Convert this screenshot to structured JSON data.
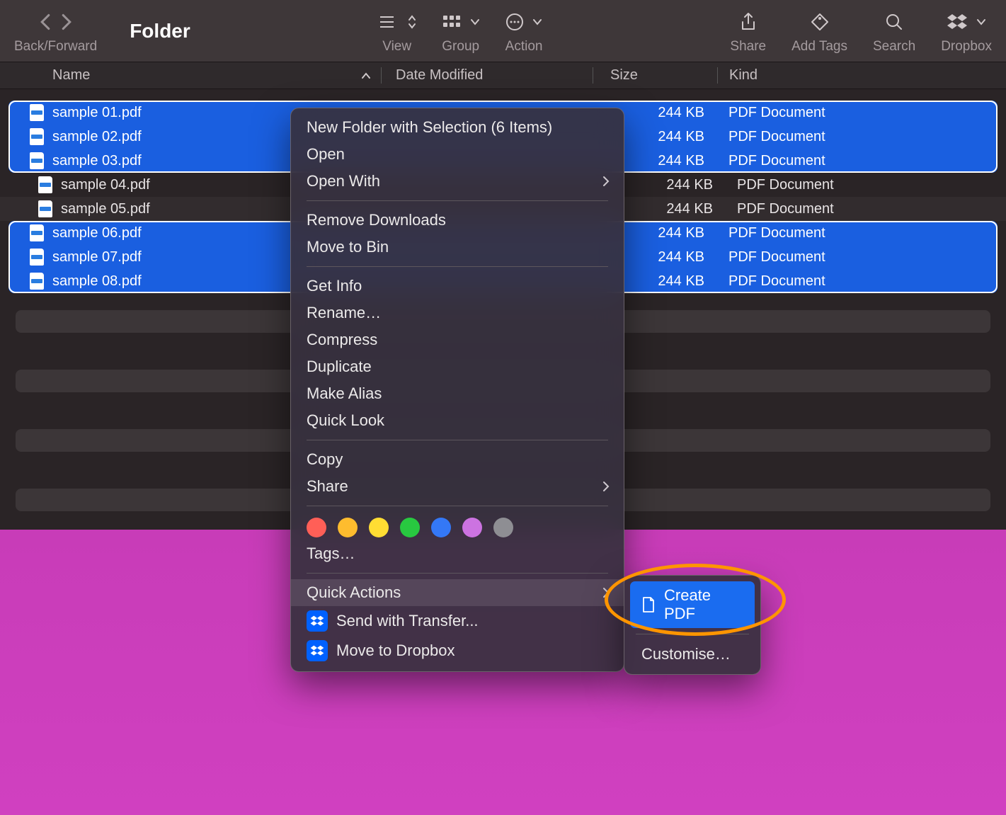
{
  "window": {
    "title": "Folder"
  },
  "toolbar": {
    "back_forward": "Back/Forward",
    "view": "View",
    "group": "Group",
    "action": "Action",
    "share": "Share",
    "add_tags": "Add Tags",
    "search": "Search",
    "dropbox": "Dropbox"
  },
  "columns": {
    "name": "Name",
    "date": "Date Modified",
    "size": "Size",
    "kind": "Kind"
  },
  "files": [
    {
      "name": "sample 01.pdf",
      "size": "244 KB",
      "kind": "PDF Document",
      "selected": true
    },
    {
      "name": "sample 02.pdf",
      "size": "244 KB",
      "kind": "PDF Document",
      "selected": true
    },
    {
      "name": "sample 03.pdf",
      "size": "244 KB",
      "kind": "PDF Document",
      "selected": true
    },
    {
      "name": "sample 04.pdf",
      "size": "244 KB",
      "kind": "PDF Document",
      "selected": false
    },
    {
      "name": "sample 05.pdf",
      "size": "244 KB",
      "kind": "PDF Document",
      "selected": false
    },
    {
      "name": "sample 06.pdf",
      "size": "244 KB",
      "kind": "PDF Document",
      "selected": true
    },
    {
      "name": "sample 07.pdf",
      "size": "244 KB",
      "kind": "PDF Document",
      "selected": true
    },
    {
      "name": "sample 08.pdf",
      "size": "244 KB",
      "kind": "PDF Document",
      "selected": true
    }
  ],
  "context_menu": {
    "new_folder": "New Folder with Selection (6 Items)",
    "open": "Open",
    "open_with": "Open With",
    "remove_downloads": "Remove Downloads",
    "move_to_bin": "Move to Bin",
    "get_info": "Get Info",
    "rename": "Rename…",
    "compress": "Compress",
    "duplicate": "Duplicate",
    "make_alias": "Make Alias",
    "quick_look": "Quick Look",
    "copy": "Copy",
    "share": "Share",
    "tags": "Tags…",
    "quick_actions": "Quick Actions",
    "send_transfer": "Send with Transfer...",
    "move_dropbox": "Move to Dropbox"
  },
  "tag_colors": [
    "#ff5f57",
    "#febc2e",
    "#ffdd33",
    "#28c840",
    "#3478f6",
    "#cc73e1",
    "#8e8e93"
  ],
  "submenu": {
    "create_pdf": "Create PDF",
    "customise": "Customise…"
  }
}
